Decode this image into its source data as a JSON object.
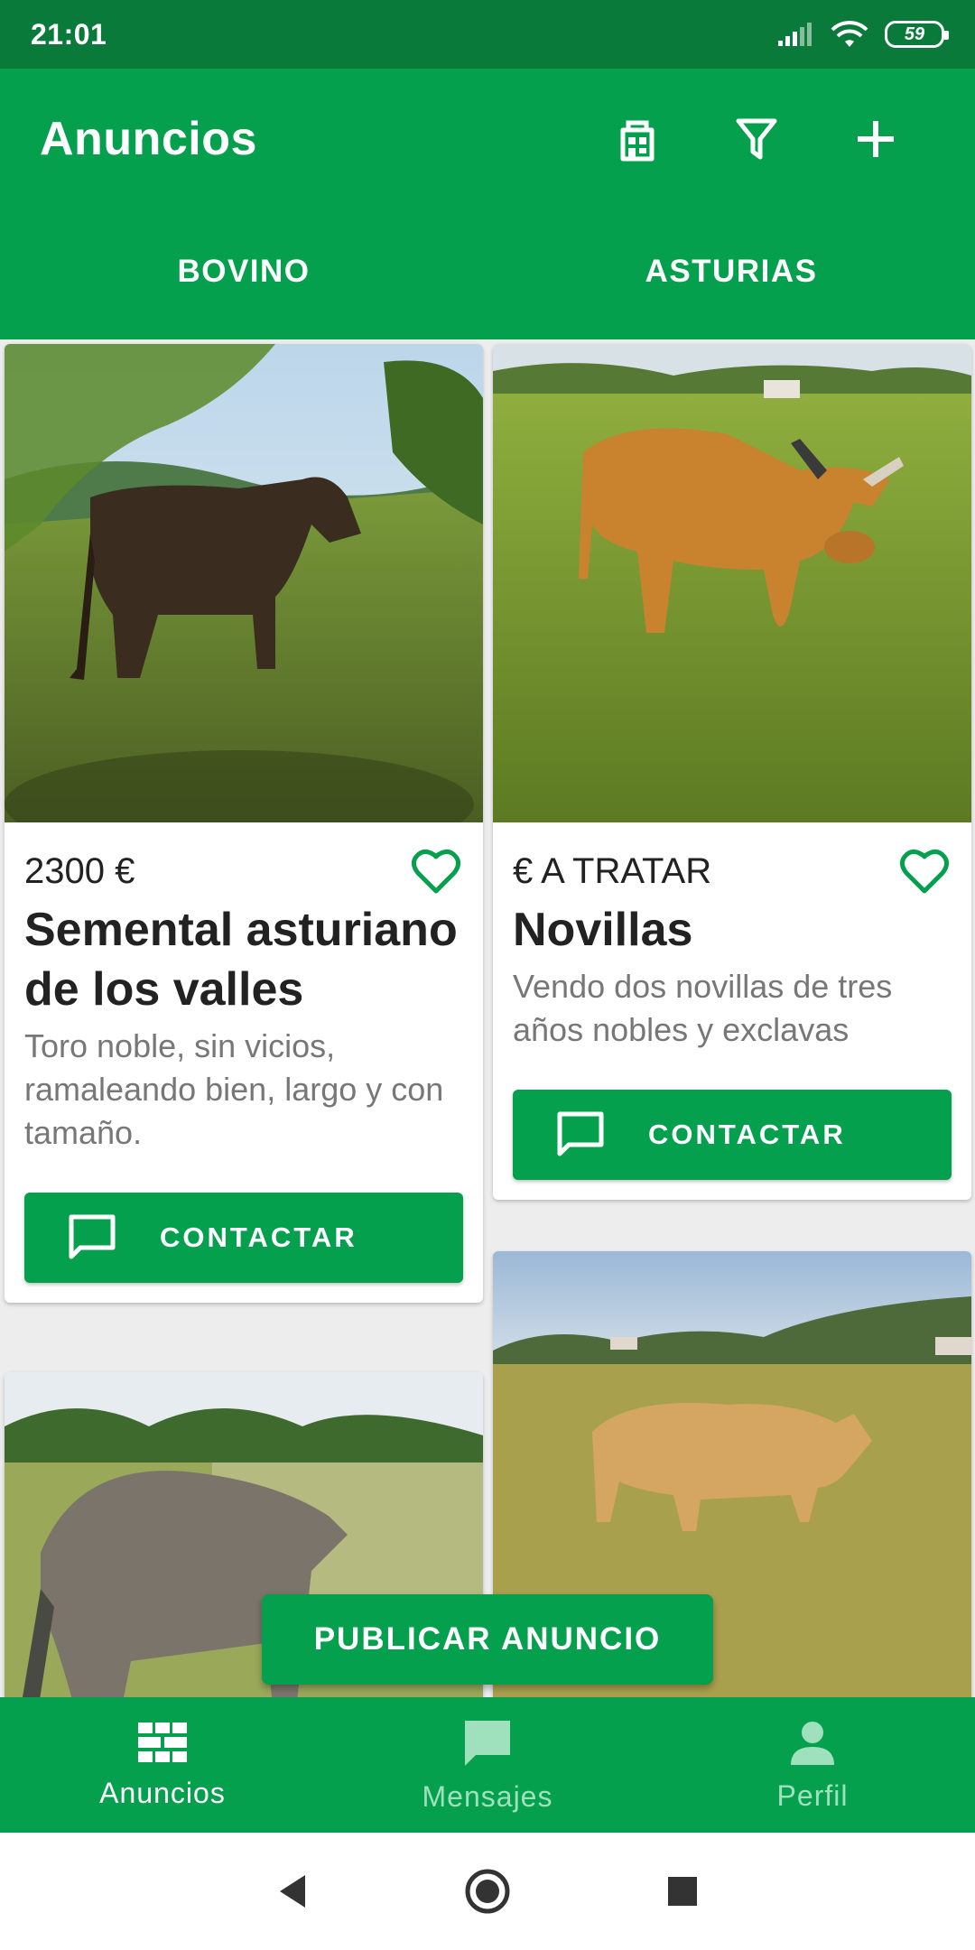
{
  "status_bar": {
    "time": "21:01",
    "battery": "59"
  },
  "app_bar": {
    "title": "Anuncios",
    "actions": [
      {
        "icon": "store-icon"
      },
      {
        "icon": "filter-icon"
      },
      {
        "icon": "add-icon"
      }
    ]
  },
  "tabs": [
    {
      "label": "BOVINO"
    },
    {
      "label": "ASTURIAS"
    }
  ],
  "listings": [
    {
      "price": "2300 €",
      "title": "Semental asturiano de los valles",
      "description": "Toro noble, sin vicios, ramaleando bien, largo y con tamaño.",
      "contact_label": "CONTACTAR",
      "photo": "dark bull on a hillside pasture"
    },
    {
      "price": "€ A TRATAR",
      "title": "Novillas",
      "description": "Vendo dos novillas de tres años nobles y exclavas",
      "contact_label": "CONTACTAR",
      "photo": "horned brown heifer in grass field"
    },
    {
      "photo": "grey-brown cow seen from behind"
    },
    {
      "photo": "light tan cow in pasture"
    }
  ],
  "fab": {
    "label": "PUBLICAR ANUNCIO"
  },
  "bottom_nav": [
    {
      "label": "Anuncios",
      "icon": "listings-grid-icon",
      "active": true
    },
    {
      "label": "Mensajes",
      "icon": "chat-icon",
      "active": false
    },
    {
      "label": "Perfil",
      "icon": "person-icon",
      "active": false
    }
  ],
  "colors": {
    "primary": "#04a04d",
    "status_bar": "#0a7a3a",
    "nav_inactive": "#9fe0bd"
  }
}
